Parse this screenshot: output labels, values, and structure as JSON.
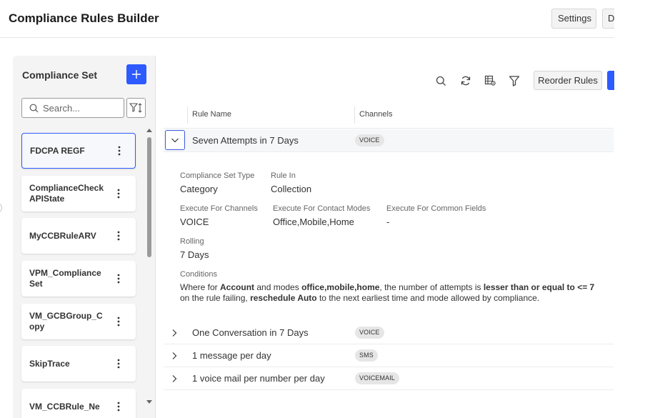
{
  "app": {
    "title": "Compliance Rules Builder"
  },
  "header": {
    "settings_label": "Settings",
    "d_label": "D"
  },
  "sidebar": {
    "title": "Compliance Set",
    "search_placeholder": "Search...",
    "items": [
      {
        "label": "FDCPA REGF",
        "selected": true
      },
      {
        "label": "ComplianceCheck APIState"
      },
      {
        "label": "MyCCBRuleARV"
      },
      {
        "label": "VPM_Compliance Set"
      },
      {
        "label": "VM_GCBGroup_C opy"
      },
      {
        "label": "SkipTrace"
      },
      {
        "label": "VM_CCBRule_Ne"
      }
    ]
  },
  "toolbar": {
    "reorder_label": "Reorder Rules",
    "icons": [
      "search-icon",
      "refresh-icon",
      "table-settings-icon",
      "filter-icon"
    ]
  },
  "table": {
    "headers": {
      "rule_name": "Rule Name",
      "channels": "Channels"
    },
    "rows": [
      {
        "name": "Seven Attempts in 7 Days",
        "channel": "VOICE",
        "expanded": true
      },
      {
        "name": "One Conversation in 7 Days",
        "channel": "VOICE"
      },
      {
        "name": "1 message per day",
        "channel": "SMS"
      },
      {
        "name": "1 voice mail per number per day",
        "channel": "VOICEMAIL"
      }
    ]
  },
  "detail": {
    "compliance_set_type_label": "Compliance Set Type",
    "compliance_set_type": "Category",
    "rule_in_label": "Rule In",
    "rule_in": "Collection",
    "exec_channels_label": "Execute For Channels",
    "exec_channels": "VOICE",
    "exec_modes_label": "Execute For Contact Modes",
    "exec_modes": "Office,Mobile,Home",
    "exec_common_label": "Execute For Common Fields",
    "exec_common": "-",
    "rolling_label": "Rolling",
    "rolling": "7 Days",
    "conditions_label": "Conditions",
    "conditions": {
      "p1": "Where for ",
      "b1": "Account",
      "p2": " and modes ",
      "b2": "office,mobile,home",
      "p3": ", the number of attempts is ",
      "b3": "lesser than or equal to <= 7",
      "p4": " on the rule failing, ",
      "b4": "reschedule Auto",
      "p5": " to the next earliest time and mode allowed by compliance."
    }
  },
  "colors": {
    "accent": "#2e5bff",
    "badge_bg": "#e6e6e6"
  }
}
